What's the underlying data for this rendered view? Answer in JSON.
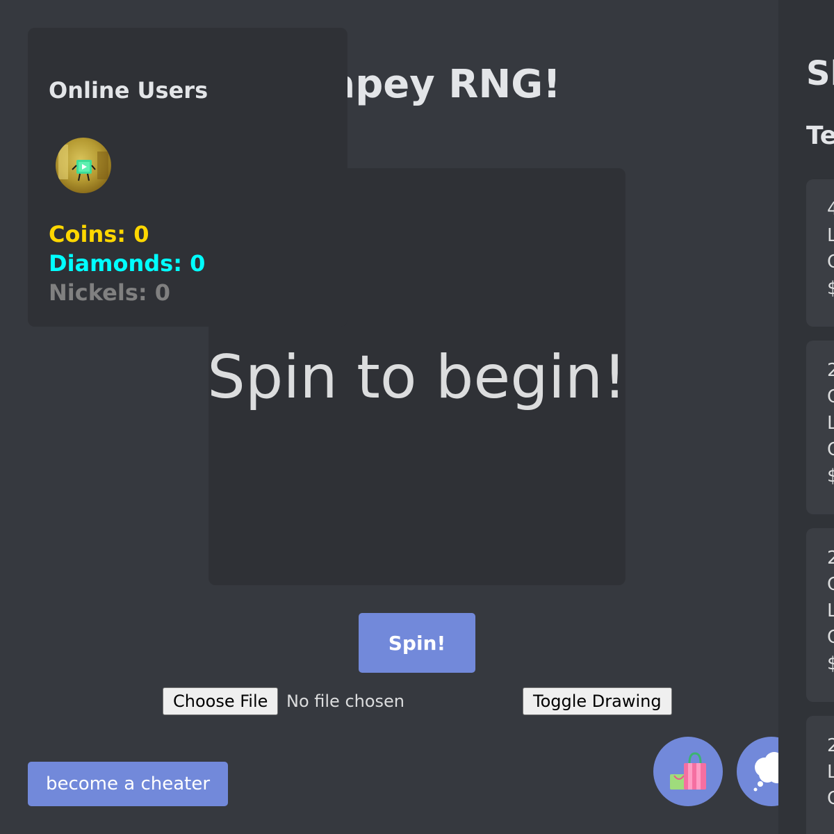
{
  "app": {
    "title": "Shapey RNG!"
  },
  "users_panel": {
    "title": "Online Users",
    "coins": "Coins: 0",
    "diamonds": "Diamonds: 0",
    "nickels": "Nickels: 0",
    "colors": {
      "coins": "#ffd700",
      "diamonds": "#00ffff",
      "nickels": "#808080"
    }
  },
  "result": {
    "text": "Spin to begin!"
  },
  "controls": {
    "spin_label": "Spin!",
    "choose_file_label": "Choose File",
    "file_status": "No file chosen",
    "toggle_drawing_label": "Toggle Drawing",
    "cheater_label": "become a cheater"
  },
  "floating_buttons": {
    "shop_icon": "shopping-bags-icon",
    "chat_icon": "thought-bubble-icon"
  },
  "shop_sidebar": {
    "title": "Sh",
    "subtitle": "Te",
    "cards": [
      {
        "lines": [
          "4",
          "L",
          "C",
          "$"
        ]
      },
      {
        "lines": [
          "2",
          "C",
          "L",
          "C",
          "$"
        ]
      },
      {
        "lines": [
          "2",
          "C",
          "L",
          "C",
          "$"
        ]
      },
      {
        "lines": [
          "2",
          "L",
          "C"
        ]
      }
    ]
  },
  "colors": {
    "background": "#36393f",
    "panel": "#2f3136",
    "accent": "#7289da",
    "text": "#dcddde"
  }
}
